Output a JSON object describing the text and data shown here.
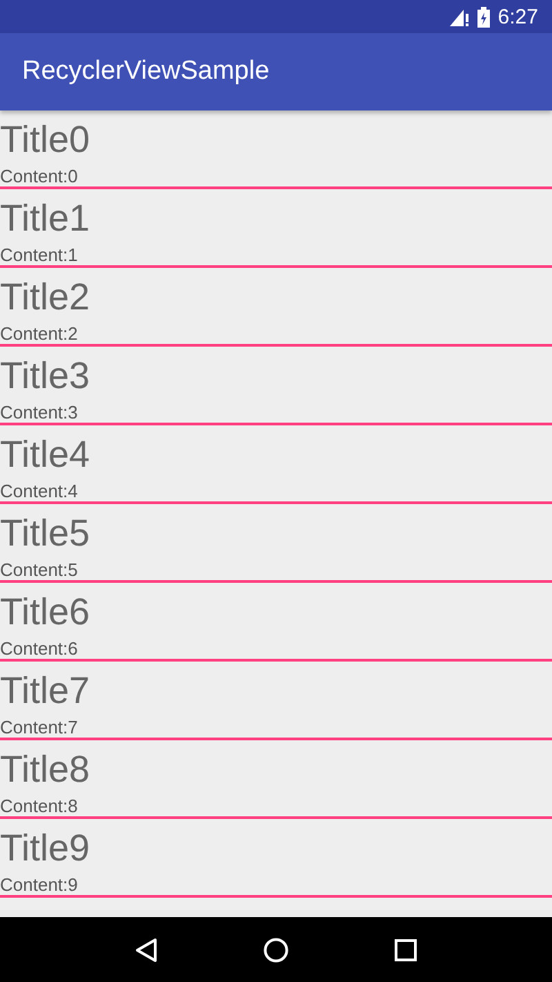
{
  "status_bar": {
    "time": "6:27"
  },
  "app_bar": {
    "title": "RecyclerViewSample"
  },
  "list": {
    "items": [
      {
        "title": "Title0",
        "content": "Content:0"
      },
      {
        "title": "Title1",
        "content": "Content:1"
      },
      {
        "title": "Title2",
        "content": "Content:2"
      },
      {
        "title": "Title3",
        "content": "Content:3"
      },
      {
        "title": "Title4",
        "content": "Content:4"
      },
      {
        "title": "Title5",
        "content": "Content:5"
      },
      {
        "title": "Title6",
        "content": "Content:6"
      },
      {
        "title": "Title7",
        "content": "Content:7"
      },
      {
        "title": "Title8",
        "content": "Content:8"
      },
      {
        "title": "Title9",
        "content": "Content:9"
      }
    ]
  }
}
